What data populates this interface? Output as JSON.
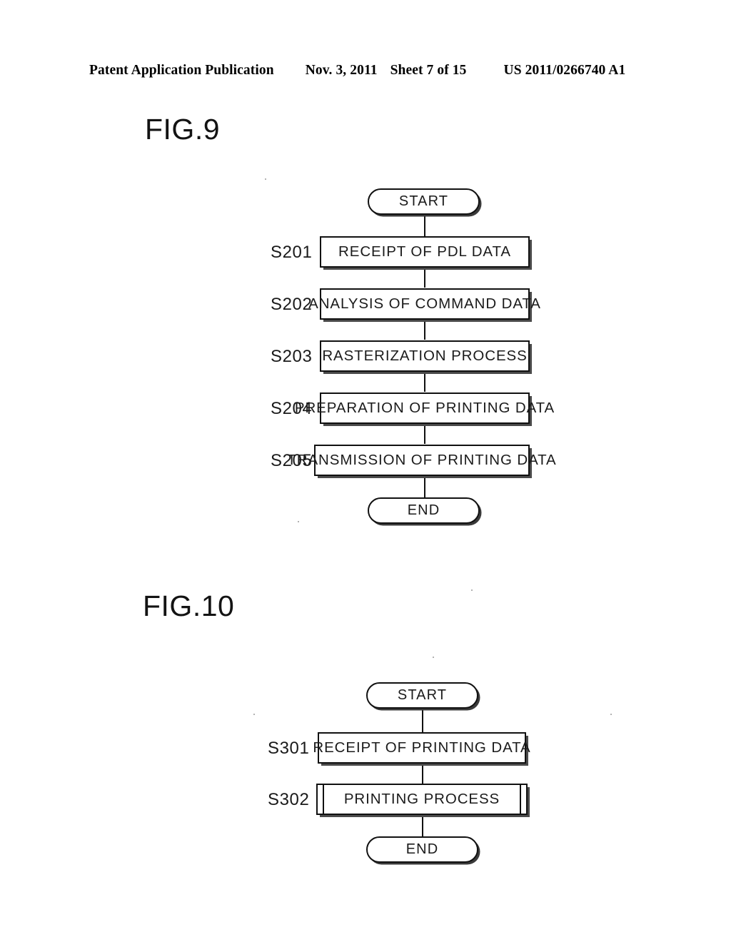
{
  "header": {
    "publication": "Patent Application Publication",
    "date": "Nov. 3, 2011",
    "sheet": "Sheet 7 of 15",
    "document_number": "US 2011/0266740 A1"
  },
  "figures": [
    {
      "title": "FIG.9",
      "nodes": [
        {
          "id": "start",
          "type": "terminator",
          "label": "START",
          "step": ""
        },
        {
          "id": "s201",
          "type": "process",
          "label": "RECEIPT OF PDL DATA",
          "step": "S201"
        },
        {
          "id": "s202",
          "type": "process",
          "label": "ANALYSIS OF COMMAND DATA",
          "step": "S202"
        },
        {
          "id": "s203",
          "type": "process",
          "label": "RASTERIZATION PROCESS",
          "step": "S203"
        },
        {
          "id": "s204",
          "type": "process",
          "label": "PREPARATION OF PRINTING DATA",
          "step": "S204"
        },
        {
          "id": "s205",
          "type": "process",
          "label": "TRANSMISSION OF PRINTING DATA",
          "step": "S205"
        },
        {
          "id": "end",
          "type": "terminator",
          "label": "END",
          "step": ""
        }
      ]
    },
    {
      "title": "FIG.10",
      "nodes": [
        {
          "id": "start",
          "type": "terminator",
          "label": "START",
          "step": ""
        },
        {
          "id": "s301",
          "type": "process",
          "label": "RECEIPT OF PRINTING DATA",
          "step": "S301"
        },
        {
          "id": "s302",
          "type": "predefined-process",
          "label": "PRINTING PROCESS",
          "step": "S302"
        },
        {
          "id": "end",
          "type": "terminator",
          "label": "END",
          "step": ""
        }
      ]
    }
  ],
  "colors": {
    "ink": "#111111",
    "paper": "#ffffff",
    "shadow": "#4a4a4a"
  }
}
